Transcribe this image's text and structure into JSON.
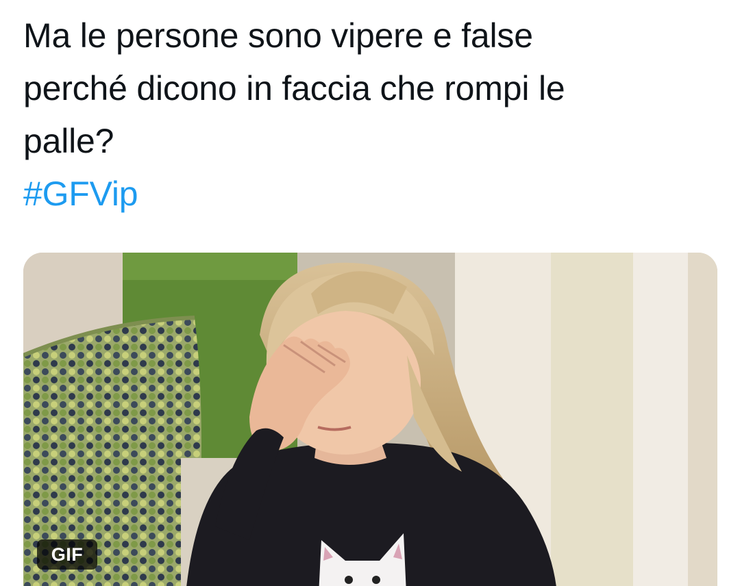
{
  "tweet": {
    "text_lines": [
      "Ma le persone sono vipere e false",
      "perché dicono in faccia che rompi le",
      "palle?"
    ],
    "hashtag": "#GFVip",
    "hashtag_color": "#1d9bf0",
    "text_color": "#0f1419"
  },
  "media": {
    "type": "gif",
    "badge_label": "GIF",
    "subject": "little girl facepalm"
  }
}
